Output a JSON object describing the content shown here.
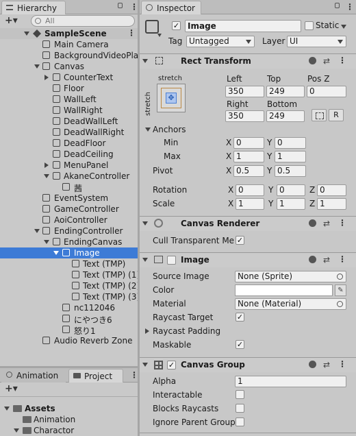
{
  "hierarchy": {
    "tab_label": "Hierarchy",
    "search_placeholder": "All",
    "add_label": "+▾",
    "scene_name": "SampleScene",
    "items": [
      {
        "label": "Main Camera"
      },
      {
        "label": "BackgroundVideoPlay"
      },
      {
        "label": "Canvas"
      },
      {
        "label": "CounterText"
      },
      {
        "label": "Floor"
      },
      {
        "label": "WallLeft"
      },
      {
        "label": "WallRight"
      },
      {
        "label": "DeadWallLeft"
      },
      {
        "label": "DeadWallRight"
      },
      {
        "label": "DeadFloor"
      },
      {
        "label": "DeadCeiling"
      },
      {
        "label": "MenuPanel"
      },
      {
        "label": "AkaneController"
      },
      {
        "label": "茜"
      },
      {
        "label": "EventSystem"
      },
      {
        "label": "GameController"
      },
      {
        "label": "AoiController"
      },
      {
        "label": "EndingController"
      },
      {
        "label": "EndingCanvas"
      },
      {
        "label": "Image"
      },
      {
        "label": "Text (TMP)"
      },
      {
        "label": "Text (TMP) (1)"
      },
      {
        "label": "Text (TMP) (2)"
      },
      {
        "label": "Text (TMP) (3)"
      },
      {
        "label": "nc112046"
      },
      {
        "label": "にやつき6"
      },
      {
        "label": "怒り1"
      },
      {
        "label": "Audio Reverb Zone"
      }
    ]
  },
  "project": {
    "tabs": [
      "Animation",
      "Project"
    ],
    "add_label": "+▾",
    "folders": [
      {
        "label": "Assets"
      },
      {
        "label": "Animation"
      },
      {
        "label": "Charactor"
      }
    ]
  },
  "inspector": {
    "tab_label": "Inspector",
    "object_name": "Image",
    "static_label": "Static",
    "tag_label": "Tag",
    "tag_value": "Untagged",
    "layer_label": "Layer",
    "layer_value": "UI",
    "rect_transform": {
      "title": "Rect Transform",
      "anchor_label_top": "stretch",
      "anchor_label_side": "stretch",
      "left_label": "Left",
      "left_value": "350",
      "top_label": "Top",
      "top_value": "249",
      "posz_label": "Pos Z",
      "posz_value": "0",
      "right_label": "Right",
      "right_value": "350",
      "bottom_label": "Bottom",
      "bottom_value": "249",
      "r_button": "R",
      "anchors_label": "Anchors",
      "min_label": "Min",
      "min_x": "0",
      "min_y": "0",
      "max_label": "Max",
      "max_x": "1",
      "max_y": "1",
      "pivot_label": "Pivot",
      "pivot_x": "0.5",
      "pivot_y": "0.5",
      "rotation_label": "Rotation",
      "rot_x": "0",
      "rot_y": "0",
      "rot_z": "0",
      "scale_label": "Scale",
      "scale_x": "1",
      "scale_y": "1",
      "scale_z": "1",
      "x": "X",
      "y": "Y",
      "z": "Z"
    },
    "canvas_renderer": {
      "title": "Canvas Renderer",
      "cull_label": "Cull Transparent Mes"
    },
    "image": {
      "title": "Image",
      "source_label": "Source Image",
      "source_value": "None (Sprite)",
      "color_label": "Color",
      "material_label": "Material",
      "material_value": "None (Material)",
      "raycast_target_label": "Raycast Target",
      "raycast_padding_label": "Raycast Padding",
      "maskable_label": "Maskable"
    },
    "canvas_group": {
      "title": "Canvas Group",
      "alpha_label": "Alpha",
      "alpha_value": "1",
      "interactable_label": "Interactable",
      "blocks_label": "Blocks Raycasts",
      "ignore_label": "Ignore Parent Groups"
    }
  },
  "colors": {
    "selection": "#3d7bd6",
    "panel": "#c8c8c8",
    "header": "#cbcbcb"
  }
}
